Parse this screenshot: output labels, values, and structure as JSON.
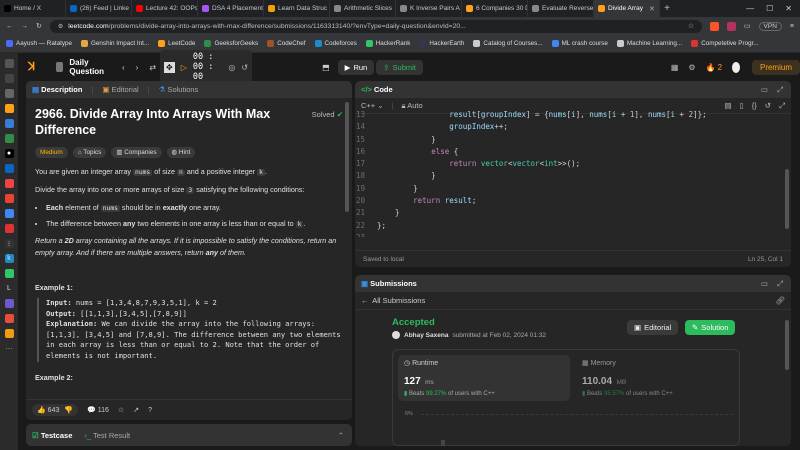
{
  "browser": {
    "tabs": [
      {
        "label": "Home / X",
        "color": "#000000"
      },
      {
        "label": "(26) Feed | Linke",
        "color": "#0a66c2"
      },
      {
        "label": "Lecture 42: OOPs",
        "color": "#ff0000"
      },
      {
        "label": "DSA 4 Placement",
        "color": "#a855f7"
      },
      {
        "label": "Learn Data Struc",
        "color": "#f59e0b"
      },
      {
        "label": "Arithmetic Slices",
        "color": "#888888"
      },
      {
        "label": "K Inverse Pairs A",
        "color": "#888888"
      },
      {
        "label": "6 Companies 30 D",
        "color": "#ffa116"
      },
      {
        "label": "Evaluate Reverse",
        "color": "#888888"
      },
      {
        "label": "Divide Array",
        "color": "#ffa116"
      }
    ],
    "url_domain": "leetcode.com",
    "url_path": "/problems/divide-array-into-arrays-with-max-difference/submissions/1163313140/?envType=daily-question&envId=20...",
    "vpn_label": "VPN",
    "bookmarks": [
      {
        "label": "Aayush — Ratatype",
        "color": "#4b6bfb"
      },
      {
        "label": "Genshin Impact Int...",
        "color": "#e5a93a"
      },
      {
        "label": "LeetCode",
        "color": "#ffa116"
      },
      {
        "label": "GeeksforGeeks",
        "color": "#2f8d46"
      },
      {
        "label": "CodeChef",
        "color": "#a0522d"
      },
      {
        "label": "Codeforces",
        "color": "#1f8acb"
      },
      {
        "label": "HackerRank",
        "color": "#2ec866"
      },
      {
        "label": "HackerEarth",
        "color": "#323754"
      },
      {
        "label": "Catalog of Courses...",
        "color": "#cccccc"
      },
      {
        "label": "ML crash course",
        "color": "#4285f4"
      },
      {
        "label": "Machine Learning...",
        "color": "#cccccc"
      },
      {
        "label": "Competetive Progr...",
        "color": "#dd3333"
      }
    ]
  },
  "nav": {
    "daily_label": "Daily Question",
    "timer": "00 : 00 : 00",
    "run_label": "Run",
    "submit_label": "Submit",
    "streak": "2",
    "premium_label": "Premium"
  },
  "description": {
    "tabs": [
      "Description",
      "Editorial",
      "Solutions"
    ],
    "title": "2966. Divide Array Into Arrays With Max Difference",
    "solved_label": "Solved",
    "tags": [
      "Medium",
      "Topics",
      "Companies",
      "Hint"
    ],
    "p1_a": "You are given an integer array ",
    "p1_code1": "nums",
    "p1_b": " of size ",
    "p1_code2": "n",
    "p1_c": " and a positive integer ",
    "p1_code3": "k",
    "p2_a": "Divide the array into one or more arrays of size ",
    "p2_code": "3",
    "p2_b": " satisfying the following conditions:",
    "b1_a": "Each",
    "b1_b": " element of ",
    "b1_code": "nums",
    "b1_c": " should be in ",
    "b1_d": "exactly",
    "b1_e": " one array.",
    "b2_a": "The difference between ",
    "b2_b": "any",
    "b2_c": " two elements in one array is less than or equal to ",
    "b2_code": "k",
    "p3_a": "Return a ",
    "p3_b": "2D",
    "p3_c": " array containing all the arrays. If it is impossible to satisfy the conditions, return an empty array. And if there are multiple answers, return ",
    "p3_d": "any",
    "p3_e": " of them.",
    "example1_label": "Example 1:",
    "ex_input_label": "Input:",
    "ex_input": " nums = [1,3,4,8,7,9,3,5,1], k = 2",
    "ex_output_label": "Output:",
    "ex_output": " [[1,1,3],[3,4,5],[7,8,9]]",
    "ex_expl_label": "Explanation:",
    "ex_expl": " We can divide the array into the following arrays: [1,1,3], [3,4,5] and [7,8,9]. The difference between any two elements in each array is less than or equal to 2. Note that the order of elements is not important.",
    "example2_label": "Example 2:",
    "likes": "643",
    "comments": "116"
  },
  "testcase": {
    "tab1": "Testcase",
    "tab2": "Test Result"
  },
  "code": {
    "header": "Code",
    "lang": "C++",
    "auto_label": "Auto",
    "saved_label": "Saved to local",
    "cursor_pos": "Ln 25, Col 1",
    "lines": [
      {
        "n": "13",
        "t": "                result[groupIndex] = {nums[i], nums[i + 1], nums[i + 2]};"
      },
      {
        "n": "14",
        "t": "                groupIndex++;"
      },
      {
        "n": "15",
        "t": "            }"
      },
      {
        "n": "16",
        "t": "            else {"
      },
      {
        "n": "17",
        "t": "                return vector<vector<int>>();"
      },
      {
        "n": "18",
        "t": "            }"
      },
      {
        "n": "19",
        "t": "        }"
      },
      {
        "n": "20",
        "t": "        return result;"
      },
      {
        "n": "21",
        "t": "    }"
      },
      {
        "n": "22",
        "t": "};"
      },
      {
        "n": "23",
        "t": ""
      },
      {
        "n": "24",
        "t": ""
      },
      {
        "n": "25",
        "t": ""
      }
    ]
  },
  "submissions": {
    "header": "Submissions",
    "back_label": "All Submissions",
    "status": "Accepted",
    "author": "Abhay Saxena",
    "submitted_at": "submitted at Feb 02, 2024 01:32",
    "editorial_label": "Editorial",
    "solution_label": "Solution",
    "runtime_label": "Runtime",
    "runtime_value": "127",
    "runtime_unit": "ms",
    "runtime_beats_label": "Beats",
    "runtime_beats": "99.27%",
    "runtime_beats_suffix": "of users with C++",
    "memory_label": "Memory",
    "memory_value": "110.04",
    "memory_unit": "MB",
    "memory_beats_label": "Beats",
    "memory_beats": "95.57%",
    "memory_beats_suffix": "of users with C++",
    "chart_tick": "6%"
  }
}
